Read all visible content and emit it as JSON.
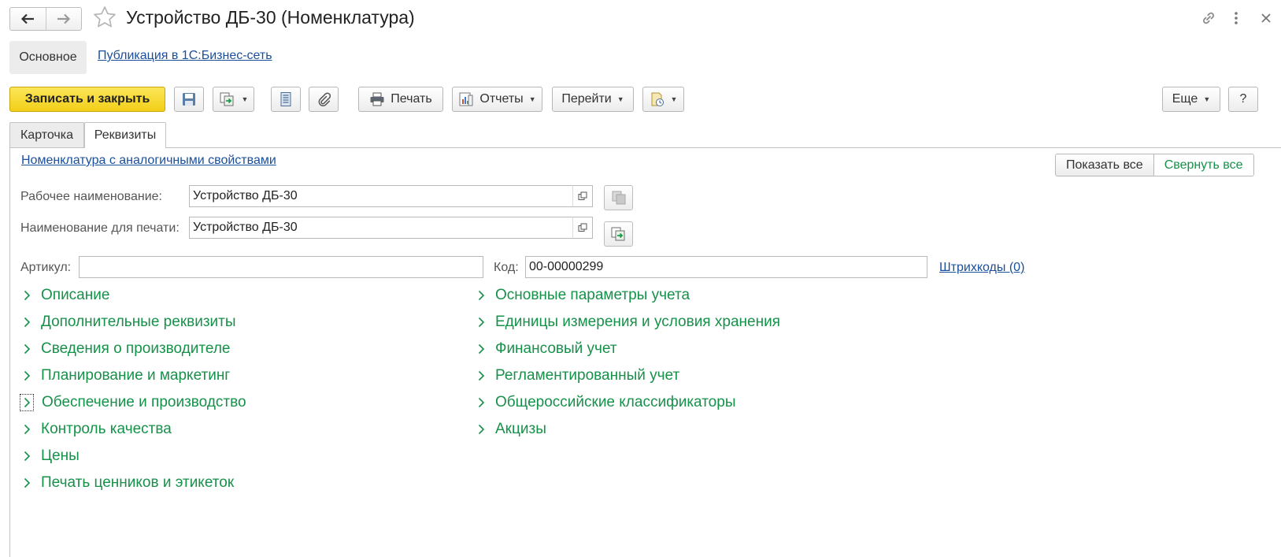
{
  "header": {
    "title": "Устройство ДБ-30 (Номенклатура)"
  },
  "sections": {
    "main_label": "Основное",
    "publication_link": "Публикация в 1С:Бизнес-сеть"
  },
  "toolbar": {
    "save_close_label": "Записать и закрыть",
    "print_label": "Печать",
    "reports_label": "Отчеты",
    "goto_label": "Перейти",
    "more_label": "Еще",
    "help_label": "?"
  },
  "tabs": [
    {
      "label": "Карточка",
      "active": false
    },
    {
      "label": "Реквизиты",
      "active": true
    }
  ],
  "form": {
    "similar_link": "Номенклатура с аналогичными свойствами",
    "show_all_label": "Показать все",
    "collapse_all_label": "Свернуть все",
    "work_name": {
      "label": "Рабочее наименование:",
      "value": "Устройство ДБ-30"
    },
    "print_name": {
      "label": "Наименование для печати:",
      "value": "Устройство ДБ-30"
    },
    "article": {
      "label": "Артикул:",
      "value": ""
    },
    "code": {
      "label": "Код:",
      "value": "00-00000299"
    },
    "barcodes_link": "Штрихкоды (0)"
  },
  "groups_left": [
    "Описание",
    "Дополнительные реквизиты",
    "Сведения о производителе",
    "Планирование и маркетинг",
    "Обеспечение и производство",
    "Контроль качества",
    "Цены",
    "Печать ценников и этикеток"
  ],
  "groups_right": [
    "Основные параметры учета",
    "Единицы измерения и условия хранения",
    "Финансовый учет",
    "Регламентированный учет",
    "Общероссийские классификаторы",
    "Акцизы"
  ],
  "colors": {
    "accent_green": "#16914a",
    "link_blue": "#1a4f9c",
    "primary_yellow": "#f2cf17"
  },
  "icons": [
    "arrow-left-icon",
    "arrow-right-icon",
    "star-icon",
    "link-icon",
    "kebab-menu-icon",
    "close-icon",
    "save-disk-icon",
    "create-based-on-icon",
    "list-icon",
    "paperclip-icon",
    "printer-icon",
    "reports-icon",
    "document-clock-icon",
    "copy-icon",
    "open-window-icon",
    "chevron-right-icon"
  ]
}
